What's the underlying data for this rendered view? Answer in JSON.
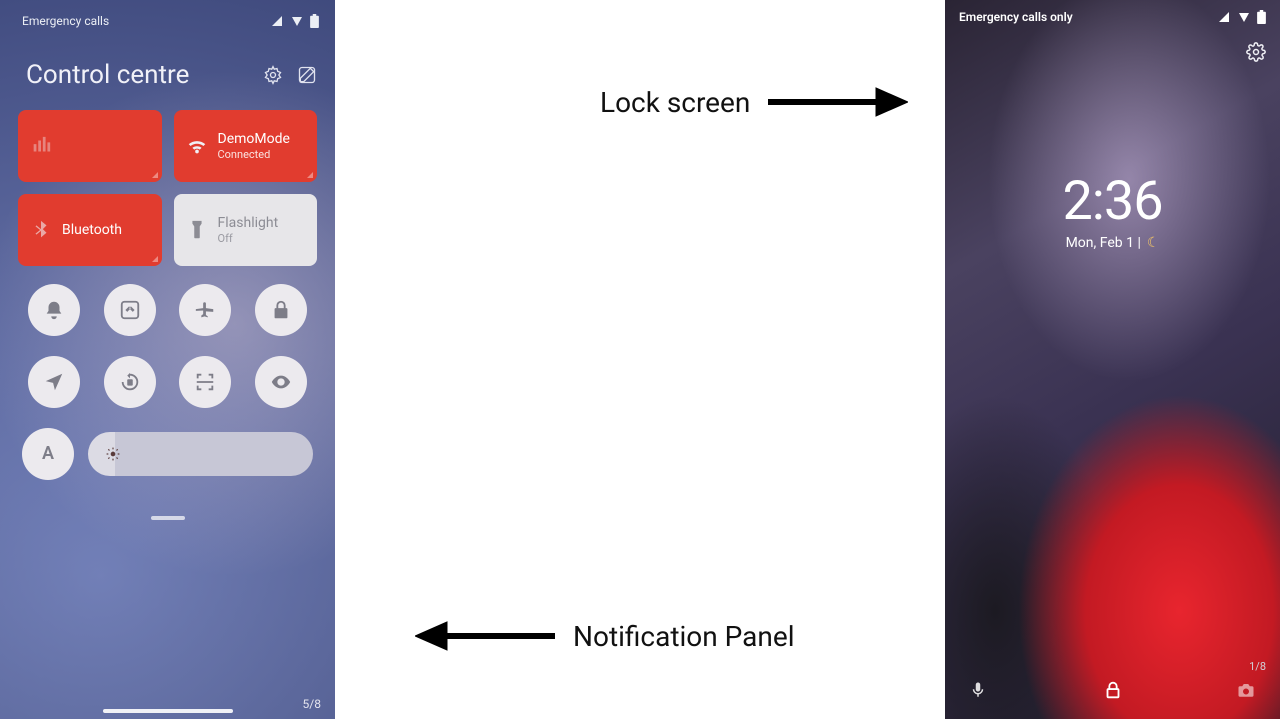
{
  "left": {
    "status_text": "Emergency calls",
    "title": "Control centre",
    "tiles": [
      {
        "title": "",
        "sub": "",
        "icon": "cellular"
      },
      {
        "title": "DemoMode",
        "sub": "Connected",
        "icon": "wifi"
      },
      {
        "title": "Bluetooth",
        "sub": "",
        "icon": "bluetooth"
      },
      {
        "title": "Flashlight",
        "sub": "Off",
        "icon": "flashlight"
      }
    ],
    "round_icons": [
      "bell",
      "scissors",
      "airplane",
      "lock",
      "location",
      "rotate-lock",
      "scan",
      "eye"
    ],
    "font_btn": "A",
    "page": "5/8"
  },
  "right": {
    "status_text": "Emergency calls only",
    "time": "2:36",
    "date": "Mon, Feb 1 |",
    "page": "1/8"
  },
  "labels": {
    "lock": "Lock screen",
    "notif": "Notification Panel"
  }
}
